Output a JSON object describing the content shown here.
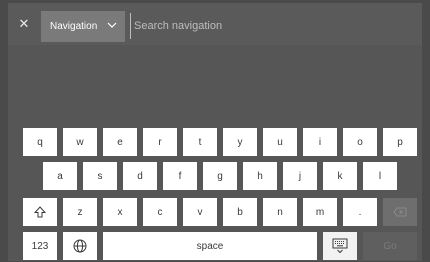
{
  "search": {
    "close_icon": "close-icon",
    "category": "Navigation",
    "placeholder": "Search navigation"
  },
  "keyboard": {
    "row1": [
      "q",
      "w",
      "e",
      "r",
      "t",
      "y",
      "u",
      "i",
      "o",
      "p"
    ],
    "row2": [
      "a",
      "s",
      "d",
      "f",
      "g",
      "h",
      "j",
      "k",
      "l"
    ],
    "row3": [
      "z",
      "x",
      "c",
      "v",
      "b",
      "n",
      "m",
      "."
    ],
    "numbers_label": "123",
    "space_label": "space",
    "go_label": "Go",
    "icons": {
      "shift": "shift-icon",
      "backspace": "backspace-icon",
      "language": "globe-icon",
      "hide_keyboard": "keyboard-hide-icon"
    }
  }
}
